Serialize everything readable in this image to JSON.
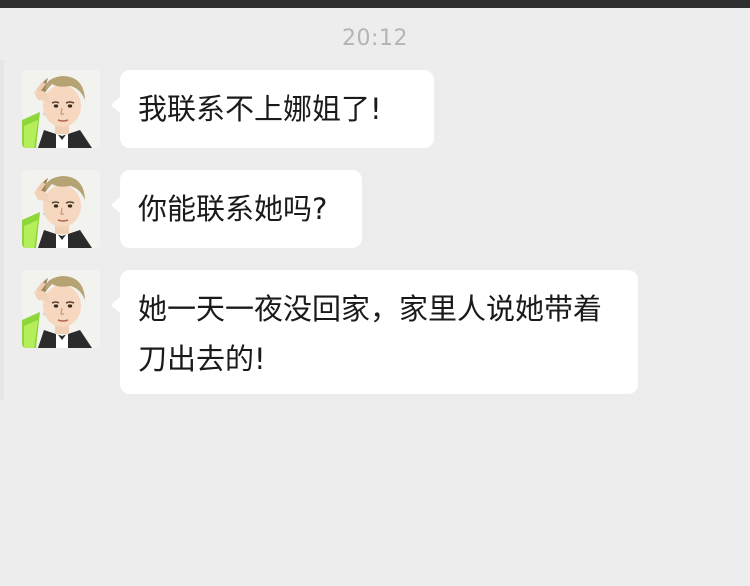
{
  "chat": {
    "timestamp": "20:12",
    "messages": [
      {
        "text": "我联系不上娜姐了!",
        "avatar": "avatar-male-character"
      },
      {
        "text": "你能联系她吗?",
        "avatar": "avatar-male-character"
      },
      {
        "text": "她一天一夜没回家，家里人说她带着刀出去的!",
        "avatar": "avatar-male-character"
      }
    ]
  },
  "colors": {
    "background": "#ededed",
    "bubble": "#ffffff",
    "timestamp": "#b4b4b4",
    "text": "#1a1a1a"
  }
}
